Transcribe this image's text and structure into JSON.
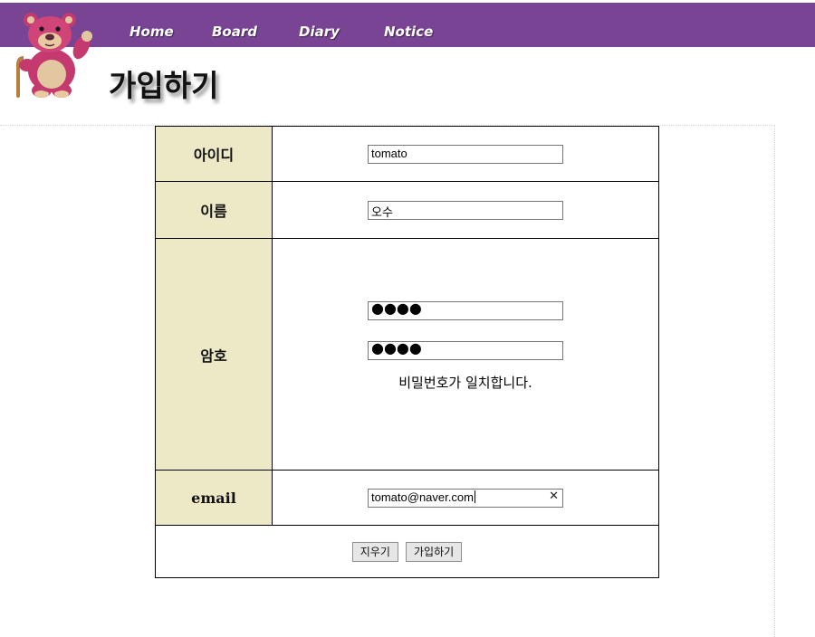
{
  "nav": {
    "items": [
      "Home",
      "Board",
      "Diary",
      "Notice"
    ]
  },
  "logo": {
    "icon": "lotso-bear-icon"
  },
  "page_title": "가입하기",
  "form": {
    "id_label": "아이디",
    "id_value": "tomato",
    "name_label": "이름",
    "name_value": "오수",
    "password_label": "암호",
    "password_value": "●●●●",
    "password_confirm_value": "●●●●",
    "password_message": "비밀번호가 일치합니다.",
    "email_label": "email",
    "email_value": "tomato@naver.com",
    "email_clear_icon": "✕"
  },
  "buttons": {
    "clear_label": "지우기",
    "submit_label": "가입하기"
  },
  "colors": {
    "header_bar": "#7a4494",
    "label_cell": "#ede8c6"
  }
}
